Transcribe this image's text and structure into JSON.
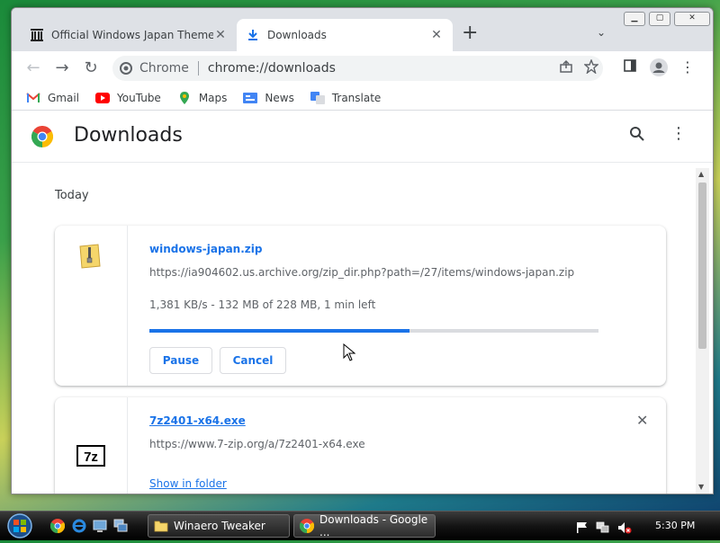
{
  "window": {
    "tabs": [
      {
        "title": "Official Windows Japan Themes a",
        "close": "✕"
      },
      {
        "title": "Downloads",
        "close": "✕"
      }
    ],
    "new_tab": "+",
    "tab_search": "⌄",
    "minimize": "▁",
    "maximize": "▢",
    "close": "✕"
  },
  "toolbar": {
    "back": "←",
    "forward": "→",
    "reload": "↻",
    "omnibox_chip": "Chrome",
    "url": "chrome://downloads"
  },
  "bookmarks": [
    {
      "label": "Gmail",
      "icon": "gmail-icon"
    },
    {
      "label": "YouTube",
      "icon": "youtube-icon"
    },
    {
      "label": "Maps",
      "icon": "maps-icon"
    },
    {
      "label": "News",
      "icon": "news-icon"
    },
    {
      "label": "Translate",
      "icon": "translate-icon"
    }
  ],
  "downloads": {
    "title": "Downloads",
    "section": "Today",
    "items": [
      {
        "filename": "windows-japan.zip",
        "url": "https://ia904602.us.archive.org/zip_dir.php?path=/27/items/windows-japan.zip",
        "status": "1,381 KB/s - 132 MB of 228 MB, 1 min left",
        "progress": 0.58,
        "pause_label": "Pause",
        "cancel_label": "Cancel"
      },
      {
        "filename": "7z2401-x64.exe",
        "url": "https://www.7-zip.org/a/7z2401-x64.exe",
        "show_label": "Show in folder",
        "remove": "✕"
      }
    ]
  },
  "taskbar": {
    "items": [
      {
        "label": "Winaero Tweaker"
      },
      {
        "label": "Downloads - Google ..."
      }
    ],
    "clock": "5:30 PM"
  },
  "colors": {
    "accent": "#1a73e8",
    "tabstrip": "#dee1e6"
  }
}
